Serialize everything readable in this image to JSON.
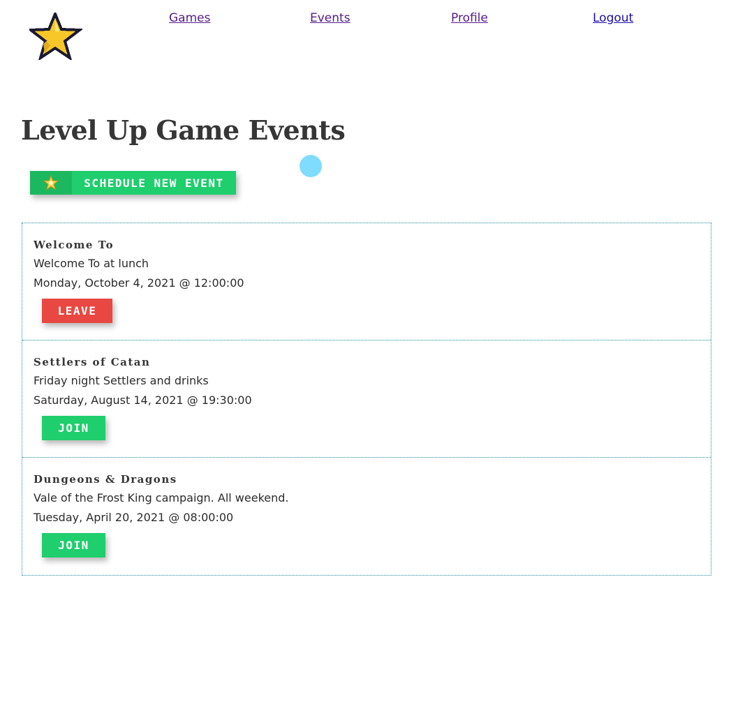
{
  "header": {
    "logo_icon": "pixel-star-icon",
    "nav": [
      {
        "label": "Games"
      },
      {
        "label": "Events"
      },
      {
        "label": "Profile"
      },
      {
        "label": "Logout"
      }
    ]
  },
  "page": {
    "title": "Level Up Game Events"
  },
  "schedule_button": {
    "icon": "star-icon",
    "label": "Schedule New Event"
  },
  "events": [
    {
      "game": "Welcome To",
      "description": "Welcome To at lunch",
      "date": "Monday, October 4, 2021 @ 12:00:00",
      "action": "Leave"
    },
    {
      "game": "Settlers of Catan",
      "description": "Friday night Settlers and drinks",
      "date": "Saturday, August 14, 2021 @ 19:30:00",
      "action": "Join"
    },
    {
      "game": "Dungeons & Dragons",
      "description": "Vale of the Frost King campaign. All weekend.",
      "date": "Tuesday, April 20, 2021 @ 08:00:00",
      "action": "Join"
    }
  ],
  "colors": {
    "join": "#1fce6d",
    "leave": "#e84841",
    "border": "#1f8a9a",
    "star_fill": "#f5c518"
  }
}
